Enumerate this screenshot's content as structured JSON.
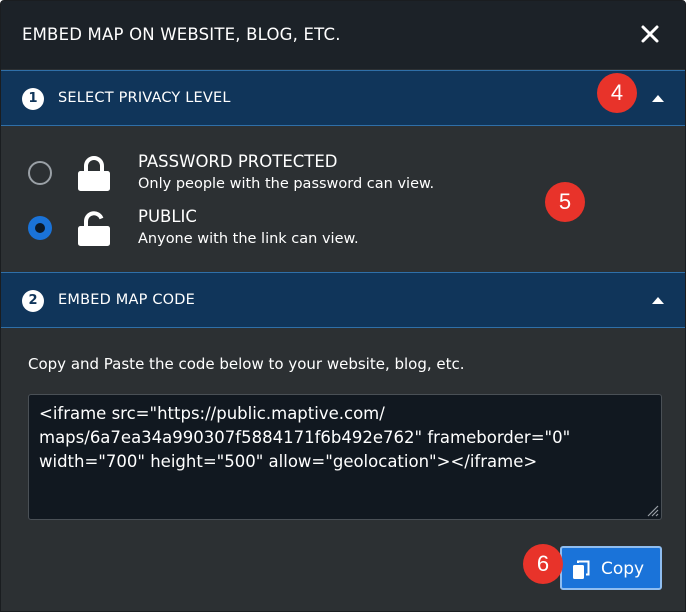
{
  "dialog": {
    "title": "EMBED MAP ON WEBSITE, BLOG, ETC.",
    "close_icon": "close-icon"
  },
  "sections": [
    {
      "number": "1",
      "title": "SELECT PRIVACY LEVEL",
      "expanded": true
    },
    {
      "number": "2",
      "title": "EMBED MAP CODE",
      "expanded": true
    }
  ],
  "privacy": {
    "options": [
      {
        "title": "PASSWORD PROTECTED",
        "description": "Only people with the password can view.",
        "icon": "lock-closed-icon",
        "selected": false
      },
      {
        "title": "PUBLIC",
        "description": "Anyone with the link can view.",
        "icon": "lock-open-icon",
        "selected": true
      }
    ]
  },
  "embed": {
    "instructions": "Copy and Paste the code below to your website, blog, etc.",
    "code": "<iframe src=\"https://public.maptive.com/\nmaps/6a7ea34a990307f5884171f6b492e762\" frameborder=\"0\"\nwidth=\"700\" height=\"500\" allow=\"geolocation\"></iframe>",
    "copy_label": "Copy",
    "copy_icon": "copy-icon"
  },
  "annotations": [
    "4",
    "5",
    "6"
  ],
  "colors": {
    "header_bg": "#1c2228",
    "section_bg": "#10355a",
    "accent": "#1a73d9",
    "badge": "#e8332a"
  }
}
